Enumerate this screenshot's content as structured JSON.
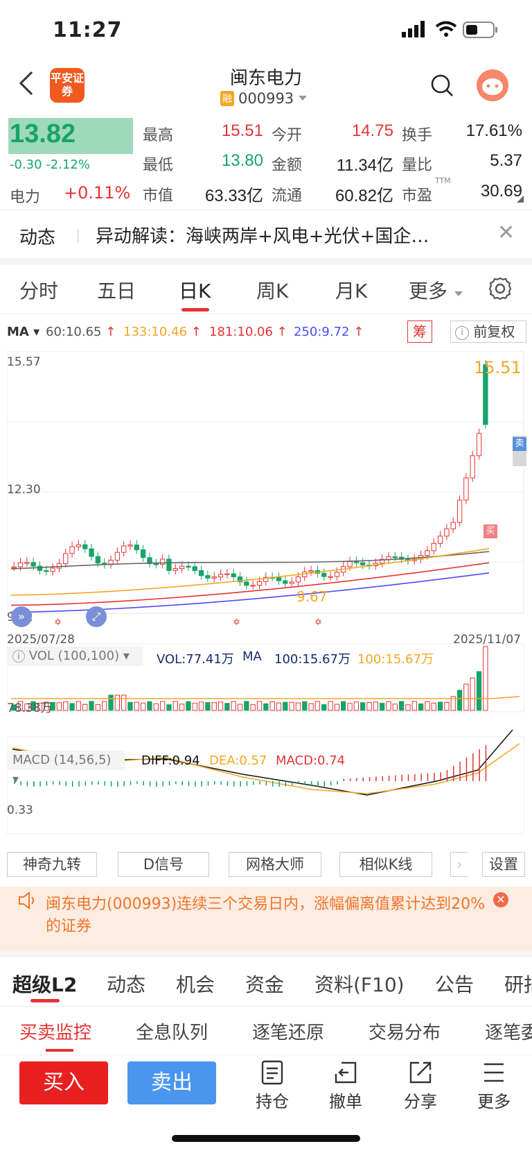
{
  "status_bar": {
    "time": "11:27"
  },
  "header": {
    "back_icon": "chevron-left-icon",
    "logo_text": "平安证券",
    "stock_name": "闽东电力",
    "margin_badge": "融",
    "stock_code": "000993"
  },
  "quote": {
    "price": "13.82",
    "change": "-0.30  -2.12%",
    "sector_name": "电力",
    "sector_change": "+0.11%",
    "fields": [
      {
        "label": "最高",
        "value": "15.51",
        "color": "red"
      },
      {
        "label": "今开",
        "value": "14.75",
        "color": "red"
      },
      {
        "label": "换手",
        "value": "17.61%",
        "color": "black"
      },
      {
        "label": "最低",
        "value": "13.80",
        "color": "green"
      },
      {
        "label": "金额",
        "value": "11.34亿",
        "color": "black"
      },
      {
        "label": "量比",
        "value": "5.37",
        "color": "black"
      },
      {
        "label": "市值",
        "value": "63.33亿",
        "color": "black"
      },
      {
        "label": "流通",
        "value": "60.82亿",
        "color": "black"
      },
      {
        "label": "市盈",
        "value": "30.69",
        "color": "black"
      }
    ],
    "pe_sup": "TTM"
  },
  "news": {
    "tag": "动态",
    "text": "异动解读：海峡两岸+风电+光伏+国企…"
  },
  "period_tabs": [
    "分时",
    "五日",
    "日K",
    "周K",
    "月K",
    "更多"
  ],
  "active_period": "日K",
  "ma": {
    "label": "MA",
    "items": [
      {
        "text": "60:10.65",
        "color": "#555555"
      },
      {
        "text": "133:10.46",
        "color": "#f5a623"
      },
      {
        "text": "181:10.06",
        "color": "#e53333"
      },
      {
        "text": "250:9.72",
        "color": "#4b4bff"
      }
    ],
    "chip_label": "筹",
    "adjust_label": "前复权"
  },
  "chart": {
    "y_top": "15.57",
    "y_mid": "12.30",
    "y_low": "9.22",
    "x_start": "2025/07/28",
    "x_end": "2025/11/07",
    "high_label": "15.51",
    "low_label": "9.67",
    "buy_mark": "买",
    "sell_mark": "卖"
  },
  "chart_data": {
    "type": "candlestick",
    "x_start": "2025/07/28",
    "x_end": "2025/11/07",
    "ylim": [
      9.22,
      15.57
    ],
    "highest": 15.51,
    "lowest": 9.67,
    "last_close": 13.82
  },
  "volume": {
    "selector": "VOL (100,100)",
    "vol_label": "VOL:77.41万",
    "ma_label": "MA",
    "ma1": "100:15.67万",
    "ma2": "100:15.67万",
    "axis_label": "78.38万"
  },
  "macd": {
    "selector": "MACD (14,56,5)",
    "diff": "DIFF:0.94",
    "dea": "DEA:0.57",
    "macd": "MACD:0.74",
    "axis_label": "0.33"
  },
  "tools": [
    "神奇九转",
    "D信号",
    "网格大师",
    "相似K线",
    "设置"
  ],
  "notice": "闽东电力(000993)连续三个交易日内，涨幅偏离值累计达到20%的证券",
  "bottom_tabs": [
    "超级L2",
    "动态",
    "机会",
    "资金",
    "资料(F10)",
    "公告",
    "研报"
  ],
  "sub_tabs": [
    "买卖监控",
    "全息队列",
    "逐笔还原",
    "交易分布",
    "逐笔委托"
  ],
  "actions": {
    "buy": "买入",
    "sell": "卖出",
    "hold": "持仓",
    "cancel": "撤单",
    "share": "分享",
    "more": "更多"
  }
}
